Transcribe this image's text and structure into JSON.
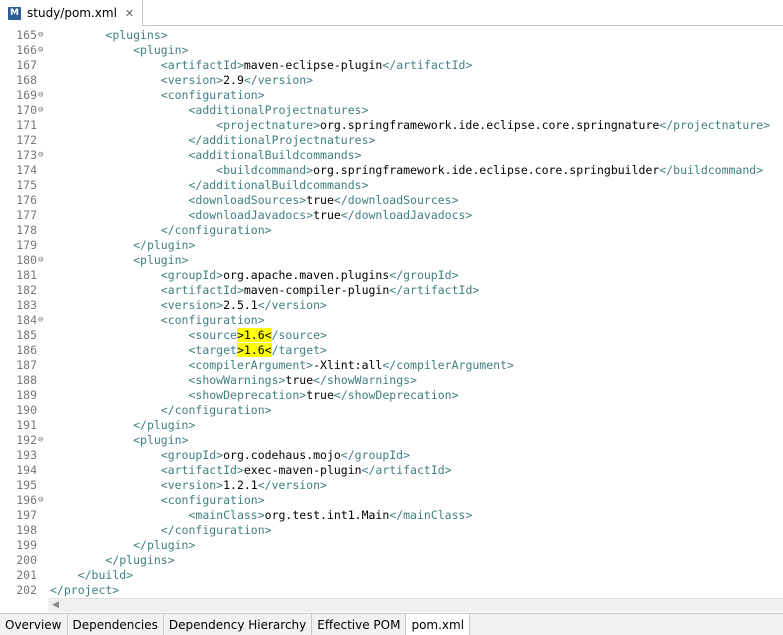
{
  "editor_tab": {
    "title": "study/pom.xml",
    "icon": "maven-file-icon",
    "icon_glyph": "M",
    "close_glyph": "✕"
  },
  "lines": [
    {
      "n": "165",
      "fold": true,
      "indent": "        ",
      "parts": [
        {
          "t": "<plugins>"
        }
      ]
    },
    {
      "n": "166",
      "fold": true,
      "indent": "            ",
      "parts": [
        {
          "t": "<plugin>"
        }
      ]
    },
    {
      "n": "167",
      "fold": false,
      "indent": "                ",
      "parts": [
        {
          "t": "<artifactId>"
        },
        {
          "b": "maven-eclipse-plugin"
        },
        {
          "t": "</artifactId>"
        }
      ]
    },
    {
      "n": "168",
      "fold": false,
      "indent": "                ",
      "parts": [
        {
          "t": "<version>"
        },
        {
          "b": "2.9"
        },
        {
          "t": "</version>"
        }
      ]
    },
    {
      "n": "169",
      "fold": true,
      "indent": "                ",
      "parts": [
        {
          "t": "<configuration>"
        }
      ]
    },
    {
      "n": "170",
      "fold": true,
      "indent": "                    ",
      "parts": [
        {
          "t": "<additionalProjectnatures>"
        }
      ]
    },
    {
      "n": "171",
      "fold": false,
      "indent": "                        ",
      "parts": [
        {
          "t": "<projectnature>"
        },
        {
          "b": "org.springframework.ide.eclipse.core.springnature"
        },
        {
          "t": "</projectnature>"
        }
      ]
    },
    {
      "n": "172",
      "fold": false,
      "indent": "                    ",
      "parts": [
        {
          "t": "</additionalProjectnatures>"
        }
      ]
    },
    {
      "n": "173",
      "fold": true,
      "indent": "                    ",
      "parts": [
        {
          "t": "<additionalBuildcommands>"
        }
      ]
    },
    {
      "n": "174",
      "fold": false,
      "indent": "                        ",
      "parts": [
        {
          "t": "<buildcommand>"
        },
        {
          "b": "org.springframework.ide.eclipse.core.springbuilder"
        },
        {
          "t": "</buildcommand>"
        }
      ]
    },
    {
      "n": "175",
      "fold": false,
      "indent": "                    ",
      "parts": [
        {
          "t": "</additionalBuildcommands>"
        }
      ]
    },
    {
      "n": "176",
      "fold": false,
      "indent": "                    ",
      "parts": [
        {
          "t": "<downloadSources>"
        },
        {
          "b": "true"
        },
        {
          "t": "</downloadSources>"
        }
      ]
    },
    {
      "n": "177",
      "fold": false,
      "indent": "                    ",
      "parts": [
        {
          "t": "<downloadJavadocs>"
        },
        {
          "b": "true"
        },
        {
          "t": "</downloadJavadocs>"
        }
      ]
    },
    {
      "n": "178",
      "fold": false,
      "indent": "                ",
      "parts": [
        {
          "t": "</configuration>"
        }
      ]
    },
    {
      "n": "179",
      "fold": false,
      "indent": "            ",
      "parts": [
        {
          "t": "</plugin>"
        }
      ]
    },
    {
      "n": "180",
      "fold": true,
      "indent": "            ",
      "parts": [
        {
          "t": "<plugin>"
        }
      ]
    },
    {
      "n": "181",
      "fold": false,
      "indent": "                ",
      "parts": [
        {
          "t": "<groupId>"
        },
        {
          "b": "org.apache.maven.plugins"
        },
        {
          "t": "</groupId>"
        }
      ]
    },
    {
      "n": "182",
      "fold": false,
      "indent": "                ",
      "parts": [
        {
          "t": "<artifactId>"
        },
        {
          "b": "maven-compiler-plugin"
        },
        {
          "t": "</artifactId>"
        }
      ]
    },
    {
      "n": "183",
      "fold": false,
      "indent": "                ",
      "parts": [
        {
          "t": "<version>"
        },
        {
          "b": "2.5.1"
        },
        {
          "t": "</version>"
        }
      ]
    },
    {
      "n": "184",
      "fold": true,
      "indent": "                ",
      "parts": [
        {
          "t": "<configuration>"
        }
      ]
    },
    {
      "n": "185",
      "fold": false,
      "indent": "                    ",
      "parts": [
        {
          "t": "<source"
        },
        {
          "h": ">1.6<"
        },
        {
          "t": "/source>"
        }
      ]
    },
    {
      "n": "186",
      "fold": false,
      "indent": "                    ",
      "parts": [
        {
          "t": "<target"
        },
        {
          "h": ">1.6<"
        },
        {
          "t": "/target>"
        }
      ]
    },
    {
      "n": "187",
      "fold": false,
      "indent": "                    ",
      "parts": [
        {
          "t": "<compilerArgument>"
        },
        {
          "b": "-Xlint:all"
        },
        {
          "t": "</compilerArgument>"
        }
      ]
    },
    {
      "n": "188",
      "fold": false,
      "indent": "                    ",
      "parts": [
        {
          "t": "<showWarnings>"
        },
        {
          "b": "true"
        },
        {
          "t": "</showWarnings>"
        }
      ]
    },
    {
      "n": "189",
      "fold": false,
      "indent": "                    ",
      "parts": [
        {
          "t": "<showDeprecation>"
        },
        {
          "b": "true"
        },
        {
          "t": "</showDeprecation>"
        }
      ]
    },
    {
      "n": "190",
      "fold": false,
      "indent": "                ",
      "parts": [
        {
          "t": "</configuration>"
        }
      ]
    },
    {
      "n": "191",
      "fold": false,
      "indent": "            ",
      "parts": [
        {
          "t": "</plugin>"
        }
      ]
    },
    {
      "n": "192",
      "fold": true,
      "indent": "            ",
      "parts": [
        {
          "t": "<plugin>"
        }
      ]
    },
    {
      "n": "193",
      "fold": false,
      "indent": "                ",
      "parts": [
        {
          "t": "<groupId>"
        },
        {
          "b": "org.codehaus.mojo"
        },
        {
          "t": "</groupId>"
        }
      ]
    },
    {
      "n": "194",
      "fold": false,
      "indent": "                ",
      "parts": [
        {
          "t": "<artifactId>"
        },
        {
          "b": "exec-maven-plugin"
        },
        {
          "t": "</artifactId>"
        }
      ]
    },
    {
      "n": "195",
      "fold": false,
      "indent": "                ",
      "parts": [
        {
          "t": "<version>"
        },
        {
          "b": "1.2.1"
        },
        {
          "t": "</version>"
        }
      ]
    },
    {
      "n": "196",
      "fold": true,
      "indent": "                ",
      "parts": [
        {
          "t": "<configuration>"
        }
      ]
    },
    {
      "n": "197",
      "fold": false,
      "indent": "                    ",
      "parts": [
        {
          "t": "<mainClass>"
        },
        {
          "b": "org.test.int1.Main"
        },
        {
          "t": "</mainClass>"
        }
      ]
    },
    {
      "n": "198",
      "fold": false,
      "indent": "                ",
      "parts": [
        {
          "t": "</configuration>"
        }
      ]
    },
    {
      "n": "199",
      "fold": false,
      "indent": "            ",
      "parts": [
        {
          "t": "</plugin>"
        }
      ]
    },
    {
      "n": "200",
      "fold": false,
      "indent": "        ",
      "parts": [
        {
          "t": "</plugins>"
        }
      ]
    },
    {
      "n": "201",
      "fold": false,
      "indent": "    ",
      "parts": [
        {
          "t": "</build>"
        }
      ]
    },
    {
      "n": "202",
      "fold": false,
      "indent": "",
      "parts": [
        {
          "t": "</project>"
        }
      ]
    }
  ],
  "fold_glyph": "⊖",
  "scroll_left_glyph": "◀",
  "bottom_tabs": [
    {
      "label": "Overview",
      "active": false
    },
    {
      "label": "Dependencies",
      "active": false
    },
    {
      "label": "Dependency Hierarchy",
      "active": false
    },
    {
      "label": "Effective POM",
      "active": false
    },
    {
      "label": "pom.xml",
      "active": true
    }
  ],
  "colors": {
    "tag": "#3f7f7f",
    "text": "#000000",
    "highlight": "#ffff00",
    "line_number": "#787878"
  }
}
